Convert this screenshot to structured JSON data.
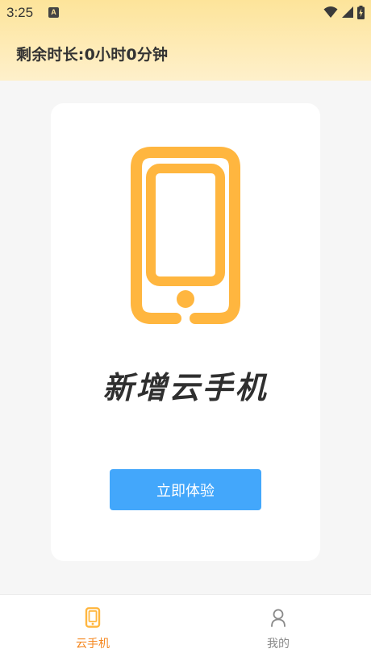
{
  "status_bar": {
    "time": "3:25",
    "notification_letter": "A",
    "icons": [
      "a-notification-icon",
      "wifi-icon",
      "signal-icon",
      "battery-charging-icon"
    ]
  },
  "header": {
    "remaining_time": "剩余时长:0小时0分钟"
  },
  "card": {
    "icon": "phone-icon",
    "title": "新增云手机",
    "button_label": "立即体验"
  },
  "bottom_nav": {
    "items": [
      {
        "label": "云手机",
        "icon": "phone-icon",
        "active": true
      },
      {
        "label": "我的",
        "icon": "user-icon",
        "active": false
      }
    ]
  },
  "colors": {
    "accent": "#ffb63f",
    "button": "#43a7fb",
    "nav_active": "#f5871f",
    "nav_inactive": "#8a8a8a",
    "header_gradient_top": "#fde49a",
    "header_gradient_bottom": "#fef0cb"
  }
}
